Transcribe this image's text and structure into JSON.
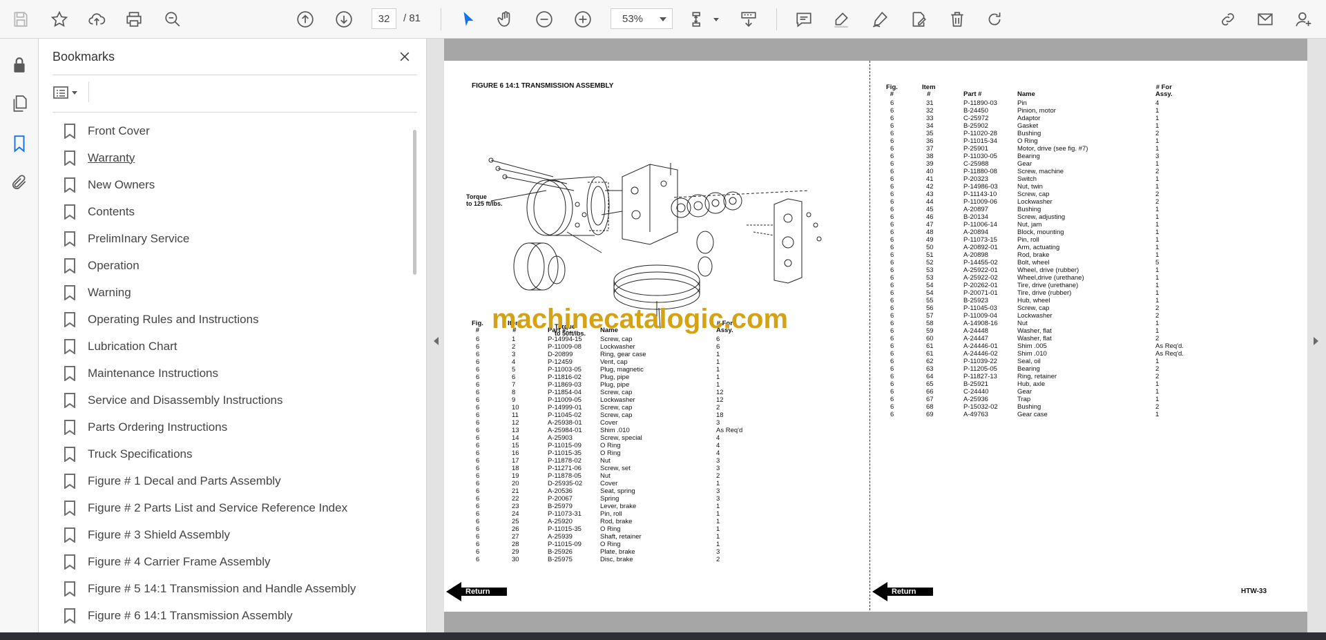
{
  "toolbar": {
    "page_current": "32",
    "page_total": "/ 81",
    "zoom": "53%"
  },
  "panel": {
    "title": "Bookmarks",
    "bookmarks": [
      "Front Cover",
      "Warranty",
      "New Owners",
      "Contents",
      "PrelimInary Service",
      "Operation",
      "Warning",
      "Operating Rules and Instructions",
      "Lubrication Chart",
      "Maintenance Instructions",
      "Service and Disassembly Instructions",
      "Parts Ordering Instructions",
      "Truck Specifications",
      "Figure # 1 Decal and Parts Assembly",
      "Figure # 2 Parts List and Service Reference Index",
      "Figure # 3 Shield Assembly",
      "Figure # 4 Carrier Frame Assembly",
      "Figure # 5 14:1 Transmission and Handle Assembly",
      "Figure # 6 14:1 Transmission Assembly"
    ]
  },
  "document": {
    "figure_title": "FIGURE 6  14:1 TRANSMISSION ASSEMBLY",
    "annotation_torque_1": "Torque\nto 125 ft/lbs.",
    "annotation_torque_2": "Torque\nto 50ft/lbs.",
    "watermark": "machinecatalogic.com",
    "return_label": "Return",
    "page_code": "HTW-33",
    "headers": {
      "fig": "Fig.\n#",
      "item": "Item\n#",
      "part": "Part #",
      "name": "Name",
      "qty": "# For\nAssy."
    },
    "left_rows": [
      [
        "6",
        "1",
        "P-14994-15",
        "Screw, cap",
        "6"
      ],
      [
        "6",
        "2",
        "P-11009-08",
        "Lockwasher",
        "6"
      ],
      [
        "6",
        "3",
        "D-20899",
        "Ring, gear case",
        "1"
      ],
      [
        "6",
        "4",
        "P-12459",
        "Vent, cap",
        "1"
      ],
      [
        "6",
        "5",
        "P-11003-05",
        "Plug, magnetic",
        "1"
      ],
      [
        "6",
        "6",
        "P-11816-02",
        "Plug, pipe",
        "1"
      ],
      [
        "6",
        "7",
        "P-11869-03",
        "Plug, pipe",
        "1"
      ],
      [
        "6",
        "8",
        "P-11854-04",
        "Screw, cap",
        "12"
      ],
      [
        "6",
        "9",
        "P-11009-05",
        "Lockwasher",
        "12"
      ],
      [
        "6",
        "10",
        "P-14999-01",
        "Screw, cap",
        "2"
      ],
      [
        "6",
        "11",
        "P-11045-02",
        "Screw, cap",
        "18"
      ],
      [
        "6",
        "12",
        "A-25938-01",
        "Cover",
        "3"
      ],
      [
        "6",
        "13",
        "A-25984-01",
        "Shim .010",
        "As Req'd"
      ],
      [
        "6",
        "14",
        "A-25903",
        "Screw, special",
        "4"
      ],
      [
        "6",
        "15",
        "P-11015-09",
        "O Ring",
        "4"
      ],
      [
        "6",
        "16",
        "P-11015-35",
        "O Ring",
        "4"
      ],
      [
        "6",
        "17",
        "P-11878-02",
        "Nut",
        "3"
      ],
      [
        "6",
        "18",
        "P-11271-06",
        "Screw, set",
        "3"
      ],
      [
        "6",
        "19",
        "P-11878-05",
        "Nut",
        "2"
      ],
      [
        "6",
        "20",
        "D-25935-02",
        "Cover",
        "1"
      ],
      [
        "6",
        "21",
        "A-20536",
        "Seat, spring",
        "3"
      ],
      [
        "6",
        "22",
        "P-20067",
        "Spring",
        "3"
      ],
      [
        "6",
        "23",
        "B-25979",
        "Lever, brake",
        "1"
      ],
      [
        "6",
        "24",
        "P-11073-31",
        "Pin, roll",
        "1"
      ],
      [
        "6",
        "25",
        "A-25920",
        "Rod, brake",
        "1"
      ],
      [
        "6",
        "26",
        "P-11015-35",
        "O Ring",
        "1"
      ],
      [
        "6",
        "27",
        "A-25939",
        "Shaft, retainer",
        "1"
      ],
      [
        "6",
        "28",
        "P-11015-09",
        "O Ring",
        "1"
      ],
      [
        "6",
        "29",
        "B-25926",
        "Plate, brake",
        "3"
      ],
      [
        "6",
        "30",
        "B-25975",
        "Disc, brake",
        "2"
      ]
    ],
    "right_rows": [
      [
        "6",
        "31",
        "P-11890-03",
        "Pin",
        "4"
      ],
      [
        "6",
        "32",
        "B-24450",
        "Pinion, motor",
        "1"
      ],
      [
        "6",
        "33",
        "C-25972",
        "Adaptor",
        "1"
      ],
      [
        "6",
        "34",
        "B-25902",
        "Gasket",
        "1"
      ],
      [
        "6",
        "35",
        "P-11020-28",
        "Bushing",
        "2"
      ],
      [
        "6",
        "36",
        "P-11015-34",
        "O Ring",
        "1"
      ],
      [
        "6",
        "37",
        "P-25901",
        "Motor, drive (see fig. #7)",
        "1"
      ],
      [
        "6",
        "38",
        "P-11030-05",
        "Bearing",
        "3"
      ],
      [
        "6",
        "39",
        "C-25988",
        "Gear",
        "1"
      ],
      [
        "6",
        "40",
        "P-11880-08",
        "Screw, machine",
        "2"
      ],
      [
        "6",
        "41",
        "P-20323",
        "Switch",
        "1"
      ],
      [
        "6",
        "42",
        "P-14986-03",
        "Nut, twin",
        "1"
      ],
      [
        "6",
        "43",
        "P-11143-10",
        "Screw, cap",
        "2"
      ],
      [
        "6",
        "44",
        "P-11009-06",
        "Lockwasher",
        "2"
      ],
      [
        "6",
        "45",
        "A-20897",
        "Bushing",
        "1"
      ],
      [
        "6",
        "46",
        "B-20134",
        "Screw, adjusting",
        "1"
      ],
      [
        "6",
        "47",
        "P-11006-14",
        "Nut, jam",
        "1"
      ],
      [
        "6",
        "48",
        "A-20894",
        "Block, mounting",
        "1"
      ],
      [
        "6",
        "49",
        "P-11073-15",
        "Pin, roll",
        "1"
      ],
      [
        "6",
        "50",
        "A-20892-01",
        "Arm, actuating",
        "1"
      ],
      [
        "6",
        "51",
        "A-20898",
        "Rod, brake",
        "1"
      ],
      [
        "6",
        "52",
        "P-14455-02",
        "Bolt, wheel",
        "5"
      ],
      [
        "6",
        "53",
        "A-25922-01",
        "Wheel, drive (rubber)",
        "1"
      ],
      [
        "6",
        "53",
        "A-25922-02",
        "Wheel,drive (urethane)",
        "1"
      ],
      [
        "6",
        "54",
        "P-20262-01",
        "Tire, drive (urethane)",
        "1"
      ],
      [
        "6",
        "54",
        "P-20071-01",
        "Tire, drive (rubber)",
        "1"
      ],
      [
        "6",
        "55",
        "B-25923",
        "Hub, wheel",
        "1"
      ],
      [
        "6",
        "56",
        "P-11045-03",
        "Screw, cap",
        "2"
      ],
      [
        "6",
        "57",
        "P-11009-04",
        "Lockwasher",
        "2"
      ],
      [
        "6",
        "58",
        "A-14908-16",
        "Nut",
        "1"
      ],
      [
        "6",
        "59",
        "A-24448",
        "Washer, flat",
        "1"
      ],
      [
        "6",
        "60",
        "A-24447",
        "Washer, flat",
        "2"
      ],
      [
        "6",
        "61",
        "A-24446-01",
        "Shim .005",
        "As Req'd."
      ],
      [
        "6",
        "61",
        "A-24446-02",
        "Shim .010",
        "As Req'd."
      ],
      [
        "6",
        "62",
        "P-11039-22",
        "Seal, oil",
        "1"
      ],
      [
        "6",
        "63",
        "P-11205-05",
        "Bearing",
        "2"
      ],
      [
        "6",
        "64",
        "P-11827-13",
        "Ring, retainer",
        "2"
      ],
      [
        "6",
        "65",
        "B-25921",
        "Hub, axle",
        "1"
      ],
      [
        "6",
        "66",
        "C-24440",
        "Gear",
        "1"
      ],
      [
        "6",
        "67",
        "A-25936",
        "Trap",
        "1"
      ],
      [
        "6",
        "68",
        "P-15032-02",
        "Bushing",
        "2"
      ],
      [
        "6",
        "69",
        "A-49763",
        "Gear case",
        "1"
      ]
    ]
  }
}
